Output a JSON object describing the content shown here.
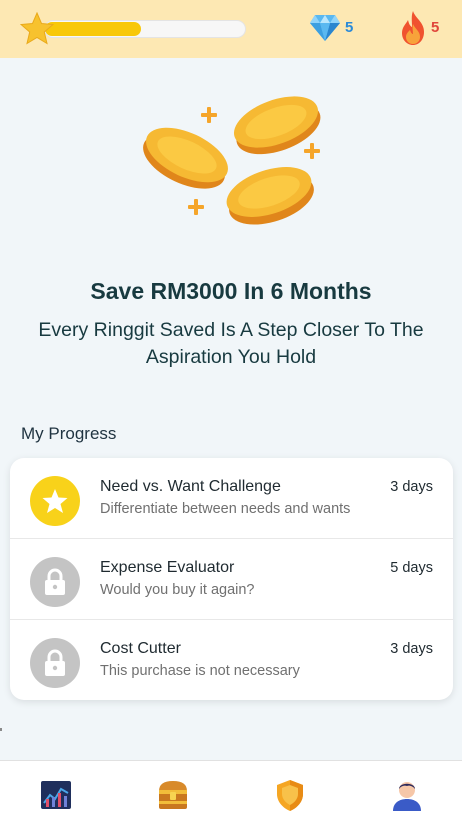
{
  "header": {
    "level_progress": 0.48,
    "gems": "5",
    "streak": "5",
    "icons": [
      "star-icon",
      "diamond-icon",
      "fire-icon"
    ],
    "colors": {
      "bar": "#fde8b3",
      "progress": "#f8c80a",
      "gem": "#2b8ad8",
      "fire": "#e0463b"
    }
  },
  "goal": {
    "title": "Save RM3000 In 6 Months",
    "subtitle": "Every Ringgit Saved Is A Step Closer To The Aspiration You Hold"
  },
  "progress": {
    "label": "My Progress",
    "items": [
      {
        "title": "Need vs. Want Challenge",
        "description": "Differentiate between needs and wants",
        "duration": "3 days",
        "status": "active",
        "icon": "star-icon"
      },
      {
        "title": "Expense Evaluator",
        "description": "Would you buy it again?",
        "duration": "5 days",
        "status": "locked",
        "icon": "lock-icon"
      },
      {
        "title": "Cost Cutter",
        "description": "This purchase is not necessary",
        "duration": "3 days",
        "status": "locked",
        "icon": "lock-icon"
      }
    ]
  },
  "nav": {
    "items": [
      {
        "icon": "chart-icon"
      },
      {
        "icon": "treasure-chest-icon"
      },
      {
        "icon": "shield-icon"
      },
      {
        "icon": "profile-icon"
      }
    ]
  }
}
